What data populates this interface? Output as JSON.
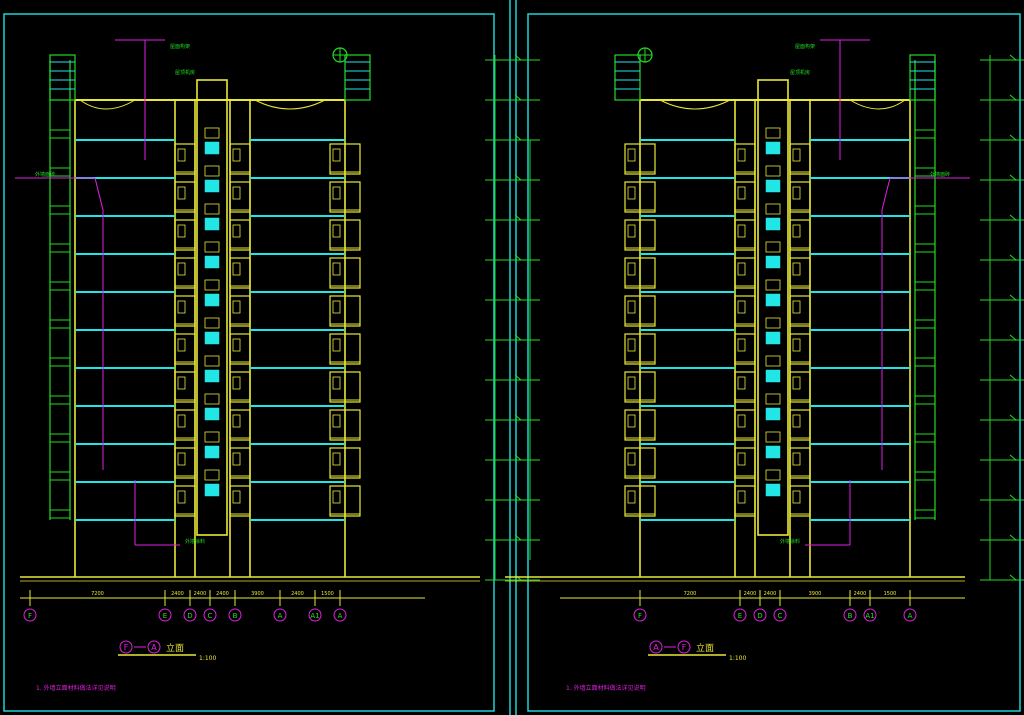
{
  "drawing": {
    "background": "#000000",
    "colors": {
      "frame": "#1fd3d6",
      "wall": "#e8e837",
      "floor_line": "#22e6e6",
      "dim": "#22dd22",
      "leader": "#e020e0",
      "window": "#22e6e6",
      "dark_line": "#7a7a00"
    }
  },
  "sheets": [
    {
      "id": "left",
      "title_text": "F — A 立面",
      "title_circle_a": "F",
      "title_circle_b": "A",
      "title_word": "立面",
      "scale": "1:100",
      "note_text": "1. 外墙立面材料做法详见说明",
      "grid_axis_labels": [
        "F",
        "E",
        "D",
        "C",
        "B",
        "A",
        "A1",
        "A"
      ],
      "dim_values": [
        "7200",
        "2400",
        "2400",
        "2400",
        "3900",
        "2400",
        "1500"
      ],
      "floors": 11,
      "leader_labels": [
        "屋面构架",
        "屋顶机房",
        "外墙面砖",
        "外墙涂料"
      ]
    },
    {
      "id": "right",
      "title_text": "A — F 立面",
      "title_circle_a": "A",
      "title_circle_b": "F",
      "title_word": "立面",
      "scale": "1:100",
      "note_text": "1. 外墙立面材料做法详见说明",
      "grid_axis_labels": [
        "A",
        "A1",
        "B",
        "C",
        "D",
        "E",
        "F"
      ],
      "dim_values": [
        "1500",
        "2400",
        "3900",
        "2400",
        "2400",
        "7200"
      ],
      "floors": 11,
      "leader_labels": [
        "屋面构架",
        "屋顶机房",
        "外墙面砖",
        "外墙涂料"
      ]
    }
  ]
}
